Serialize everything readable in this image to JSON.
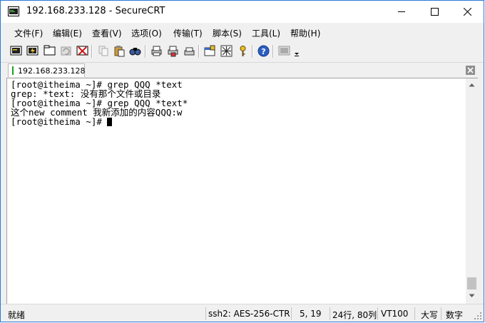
{
  "window": {
    "title": "192.168.233.128 - SecureCRT"
  },
  "menu": [
    "文件(F)",
    "编辑(E)",
    "查看(V)",
    "选项(O)",
    "传输(T)",
    "脚本(S)",
    "工具(L)",
    "帮助(H)"
  ],
  "toolbar": {
    "icons": [
      "connect-icon",
      "quick-connect-icon",
      "connect-in-tab-icon",
      "reconnect-icon",
      "disconnect-icon",
      "copy-icon",
      "paste-icon",
      "find-icon",
      "print-icon",
      "print-setup-icon",
      "session-options-icon",
      "global-options-icon",
      "keymap-icon",
      "help-icon",
      "sftp-icon",
      "toolbar-overflow-icon"
    ]
  },
  "tab": {
    "label": "192.168.233.128",
    "status_color": "#1aa31a"
  },
  "terminal": {
    "lines": [
      "[root@itheima ~]# grep QQQ *text",
      "grep: *text: 没有那个文件或目录",
      "[root@itheima ~]# grep QQQ *text*",
      "这个new comment 我新添加的内容QQQ:w",
      "[root@itheima ~]# "
    ]
  },
  "status": {
    "ready": "就绪",
    "cipher": "ssh2: AES-256-CTR",
    "cursor_pos": "5, 19",
    "size": "24行, 80列",
    "emulation": "VT100",
    "caps": "大写",
    "num": "数字"
  },
  "colors": {
    "accent": "#2b79d7",
    "terminal_bg": "#ffffff"
  }
}
